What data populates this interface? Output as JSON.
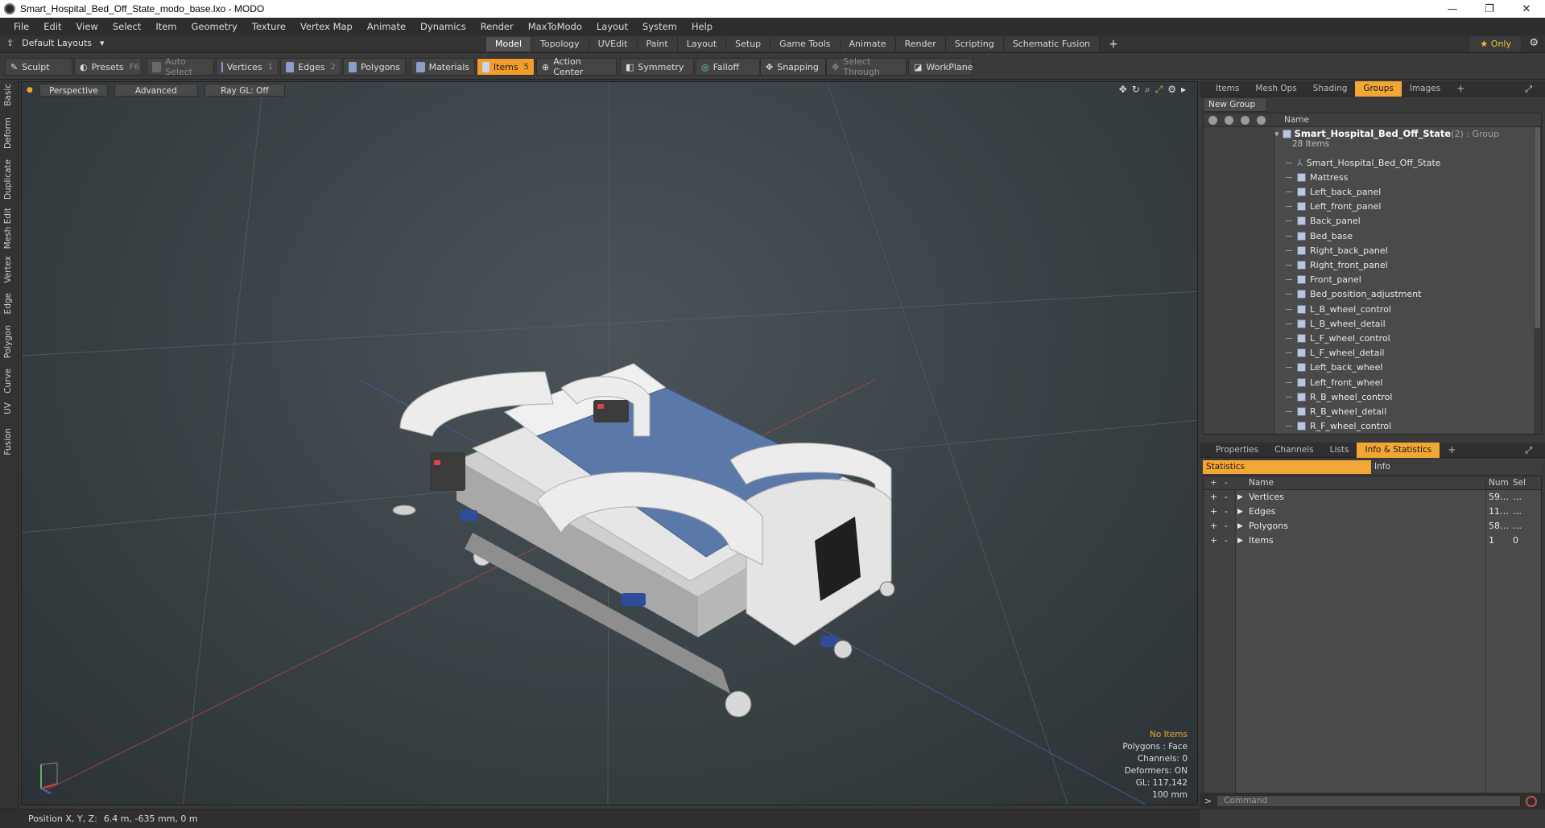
{
  "window": {
    "title": "Smart_Hospital_Bed_Off_State_modo_base.lxo - MODO",
    "minimize": "—",
    "maximize": "❐",
    "close": "✕"
  },
  "menu": [
    "File",
    "Edit",
    "View",
    "Select",
    "Item",
    "Geometry",
    "Texture",
    "Vertex Map",
    "Animate",
    "Dynamics",
    "Render",
    "MaxToModo",
    "Layout",
    "System",
    "Help"
  ],
  "layout_tabs": {
    "layouts_label": "Default Layouts",
    "tabs": [
      "Model",
      "Topology",
      "UVEdit",
      "Paint",
      "Layout",
      "Setup",
      "Game Tools",
      "Animate",
      "Render",
      "Scripting",
      "Schematic Fusion"
    ],
    "active": "Model",
    "only_label": "Only"
  },
  "toolbar": {
    "sculpt": "Sculpt",
    "presets": "Presets",
    "presets_key": "F6",
    "auto_select": "Auto Select",
    "vertices": "Vertices",
    "vertices_key": "1",
    "edges": "Edges",
    "edges_key": "2",
    "polygons": "Polygons",
    "materials": "Materials",
    "items": "Items",
    "items_key": "5",
    "action_center": "Action Center",
    "symmetry": "Symmetry",
    "falloff": "Falloff",
    "snapping": "Snapping",
    "select_through": "Select Through",
    "workplane": "WorkPlane"
  },
  "left_tabs": [
    "Basic",
    "Deform",
    "Duplicate",
    "Mesh Edit",
    "Vertex",
    "Edge",
    "Polygon",
    "Curve",
    "UV",
    "Fusion"
  ],
  "viewport": {
    "perspective": "Perspective",
    "advanced": "Advanced",
    "raygl": "Ray GL: Off",
    "stats": {
      "no_items": "No Items",
      "polygons": "Polygons : Face",
      "channels": "Channels: 0",
      "deformers": "Deformers: ON",
      "gl": "GL: 117,142",
      "grid": "100 mm"
    }
  },
  "top_panel": {
    "tabs": [
      "Items",
      "Mesh Ops",
      "Shading",
      "Groups",
      "Images"
    ],
    "active": "Groups",
    "new_group": "New Group",
    "name_header": "Name",
    "group_name": "Smart_Hospital_Bed_Off_State",
    "group_suffix": " (2) : Group",
    "group_count": "28 Items",
    "items": [
      "Smart_Hospital_Bed_Off_State",
      "Mattress",
      "Left_back_panel",
      "Left_front_panel",
      "Back_panel",
      "Bed_base",
      "Right_back_panel",
      "Right_front_panel",
      "Front_panel",
      "Bed_position_adjustment",
      "L_B_wheel_control",
      "L_B_wheel_detail",
      "L_F_wheel_control",
      "L_F_wheel_detail",
      "Left_back_wheel",
      "Left_front_wheel",
      "R_B_wheel_control",
      "R_B_wheel_detail",
      "R_F_wheel_control"
    ]
  },
  "bottom_panel": {
    "tabs": [
      "Properties",
      "Channels",
      "Lists",
      "Info & Statistics"
    ],
    "active": "Info & Statistics",
    "statistics": "Statistics",
    "info": "Info",
    "headers": {
      "name": "Name",
      "num": "Num",
      "sel": "Sel"
    },
    "rows": [
      {
        "name": "Vertices",
        "num": "59…",
        "sel": "…"
      },
      {
        "name": "Edges",
        "num": "11…",
        "sel": "…"
      },
      {
        "name": "Polygons",
        "num": "58…",
        "sel": "…"
      },
      {
        "name": "Items",
        "num": "1",
        "sel": "0"
      }
    ]
  },
  "command_placeholder": "Command",
  "status": {
    "label": "Position X, Y, Z:",
    "value": "6.4 m, -635 mm, 0 m"
  },
  "colors": {
    "accent": "#f2a634",
    "mattress": "#5a79a8",
    "frame": "#e8e8e8"
  }
}
